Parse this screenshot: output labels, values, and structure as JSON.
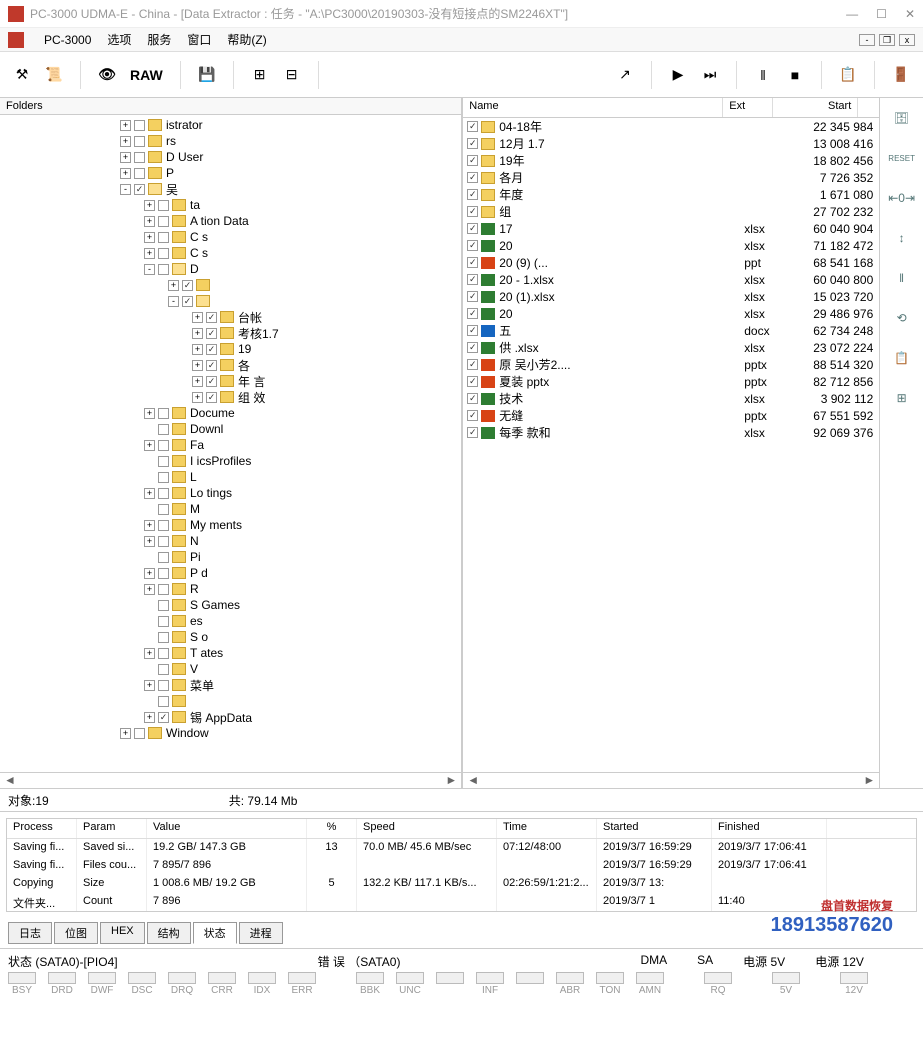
{
  "window": {
    "title": "PC-3000 UDMA-E - China - [Data Extractor : 任务 - \"A:\\PC3000\\20190303-没有短接点的SM2246XT\"]"
  },
  "menubar": {
    "app": "PC-3000",
    "items": [
      "选项",
      "服务",
      "窗口",
      "帮助(Z)"
    ]
  },
  "toolbar": {
    "raw_label": "RAW"
  },
  "sidebar_icons": [
    "RESET",
    "⇤0⇥",
    "↕",
    "‖",
    "⟲",
    "📋",
    "⊞"
  ],
  "folders_label": "Folders",
  "tree": [
    {
      "depth": 0,
      "exp": "+",
      "chk": false,
      "label": "    istrator",
      "blur": true
    },
    {
      "depth": 0,
      "exp": "+",
      "chk": false,
      "label": "    rs",
      "blur": true
    },
    {
      "depth": 0,
      "exp": "+",
      "chk": false,
      "label": "D    User",
      "blur": true
    },
    {
      "depth": 0,
      "exp": "+",
      "chk": false,
      "label": "P   ",
      "blur": true
    },
    {
      "depth": 0,
      "exp": "-",
      "chk": true,
      "open": true,
      "label": "吴  "
    },
    {
      "depth": 1,
      "exp": "+",
      "chk": false,
      "label": "    ta",
      "blur": true
    },
    {
      "depth": 1,
      "exp": "+",
      "chk": false,
      "label": "A    tion Data",
      "blur": true
    },
    {
      "depth": 1,
      "exp": "+",
      "chk": false,
      "label": "C    s",
      "blur": true
    },
    {
      "depth": 1,
      "exp": "+",
      "chk": false,
      "label": "C    s",
      "blur": true
    },
    {
      "depth": 1,
      "exp": "-",
      "chk": false,
      "open": true,
      "label": "D    ",
      "blur": true
    },
    {
      "depth": 2,
      "exp": "+",
      "chk": true,
      "label": "    ",
      "blur": true
    },
    {
      "depth": 2,
      "exp": "-",
      "chk": true,
      "open": true,
      "label": "    ",
      "blur": true
    },
    {
      "depth": 3,
      "exp": "+",
      "chk": true,
      "label": "        台帐",
      "blur": true
    },
    {
      "depth": 3,
      "exp": "+",
      "chk": true,
      "label": "        考核1.7",
      "blur": true
    },
    {
      "depth": 3,
      "exp": "+",
      "chk": true,
      "label": "19      ",
      "blur": true
    },
    {
      "depth": 3,
      "exp": "+",
      "chk": true,
      "label": "各      ",
      "blur": true
    },
    {
      "depth": 3,
      "exp": "+",
      "chk": true,
      "label": "年      言",
      "blur": true
    },
    {
      "depth": 3,
      "exp": "+",
      "chk": true,
      "label": "组    效",
      "blur": true
    },
    {
      "depth": 1,
      "exp": "+",
      "chk": false,
      "label": "Docume   ",
      "blur": true
    },
    {
      "depth": 1,
      "exp": "",
      "chk": false,
      "label": "Downl   ",
      "blur": true
    },
    {
      "depth": 1,
      "exp": "+",
      "chk": false,
      "label": "Fa   ",
      "blur": true
    },
    {
      "depth": 1,
      "exp": "",
      "chk": false,
      "label": "I      icsProfiles",
      "blur": true
    },
    {
      "depth": 1,
      "exp": "",
      "chk": false,
      "label": "L   ",
      "blur": true
    },
    {
      "depth": 1,
      "exp": "+",
      "chk": false,
      "label": "Lo    tings",
      "blur": true
    },
    {
      "depth": 1,
      "exp": "",
      "chk": false,
      "label": "M   ",
      "blur": true
    },
    {
      "depth": 1,
      "exp": "+",
      "chk": false,
      "label": "My    ments",
      "blur": true
    },
    {
      "depth": 1,
      "exp": "+",
      "chk": false,
      "label": "N   ",
      "blur": true
    },
    {
      "depth": 1,
      "exp": "",
      "chk": false,
      "label": "Pi   ",
      "blur": true
    },
    {
      "depth": 1,
      "exp": "+",
      "chk": false,
      "label": "P    d",
      "blur": true
    },
    {
      "depth": 1,
      "exp": "+",
      "chk": false,
      "label": "R   ",
      "blur": true
    },
    {
      "depth": 1,
      "exp": "",
      "chk": false,
      "label": "S     Games",
      "blur": true
    },
    {
      "depth": 1,
      "exp": "",
      "chk": false,
      "label": "    es",
      "blur": true
    },
    {
      "depth": 1,
      "exp": "",
      "chk": false,
      "label": "S    o",
      "blur": true
    },
    {
      "depth": 1,
      "exp": "+",
      "chk": false,
      "label": "T    ates",
      "blur": true
    },
    {
      "depth": 1,
      "exp": "",
      "chk": false,
      "label": "V   ",
      "blur": true
    },
    {
      "depth": 1,
      "exp": "+",
      "chk": false,
      "label": "    菜单",
      "blur": true
    },
    {
      "depth": 1,
      "exp": "",
      "chk": false,
      "label": "    ",
      "blur": true
    },
    {
      "depth": 1,
      "exp": "+",
      "chk": true,
      "label": "锡     AppData",
      "blur": true
    },
    {
      "depth": 0,
      "exp": "+",
      "chk": false,
      "label": "Window   ",
      "blur": true
    }
  ],
  "file_columns": {
    "name": "Name",
    "ext": "Ext",
    "start": "Start"
  },
  "files": [
    {
      "icon": "folder",
      "name": "04-18年",
      "ext": "",
      "start": "22 345 984"
    },
    {
      "icon": "folder",
      "name": "12月             1.7",
      "ext": "",
      "start": "13 008 416"
    },
    {
      "icon": "folder",
      "name": "19年",
      "ext": "",
      "start": "18 802 456"
    },
    {
      "icon": "folder",
      "name": "各月",
      "ext": "",
      "start": "7 726 352"
    },
    {
      "icon": "folder",
      "name": "年度",
      "ext": "",
      "start": "1 671 080"
    },
    {
      "icon": "folder",
      "name": "组",
      "ext": "",
      "start": "27 702 232"
    },
    {
      "icon": "xlsx",
      "name": "17",
      "ext": "xlsx",
      "start": "60 040 904"
    },
    {
      "icon": "xlsx",
      "name": "20",
      "ext": "xlsx",
      "start": "71 182 472"
    },
    {
      "icon": "ppt",
      "name": "20                     (9) (...",
      "ext": "ppt",
      "start": "68 541 168"
    },
    {
      "icon": "xlsx",
      "name": "20                    - 1.xlsx",
      "ext": "xlsx",
      "start": "60 040 800"
    },
    {
      "icon": "xlsx",
      "name": "20                (1).xlsx",
      "ext": "xlsx",
      "start": "15 023 720"
    },
    {
      "icon": "xlsx",
      "name": "20",
      "ext": "xlsx",
      "start": "29 486 976"
    },
    {
      "icon": "docx",
      "name": "五",
      "ext": "docx",
      "start": "62 734 248"
    },
    {
      "icon": "xlsx",
      "name": "供                   .xlsx",
      "ext": "xlsx",
      "start": "23 072 224"
    },
    {
      "icon": "pptx",
      "name": "原                   吴小芳2....",
      "ext": "pptx",
      "start": "88 514 320"
    },
    {
      "icon": "pptx",
      "name": "夏装                pptx",
      "ext": "pptx",
      "start": "82 712 856"
    },
    {
      "icon": "xlsx",
      "name": "技术",
      "ext": "xlsx",
      "start": "3 902 112"
    },
    {
      "icon": "pptx",
      "name": "无缝",
      "ext": "pptx",
      "start": "67 551 592"
    },
    {
      "icon": "xlsx",
      "name": "每季      款和",
      "ext": "xlsx",
      "start": "92 069 376"
    }
  ],
  "status": {
    "objects_label": "对象:",
    "objects": "19",
    "total_label": "共:",
    "total": "79.14 Mb"
  },
  "process_cols": [
    "Process",
    "Param",
    "Value",
    "%",
    "Speed",
    "Time",
    "Started",
    "Finished"
  ],
  "processes": [
    {
      "proc": "Saving fi...",
      "param": "Saved si...",
      "val": "19.2 GB/ 147.3 GB",
      "pct": "13",
      "spd": "70.0 MB/ 45.6 MB/sec",
      "time": "07:12/48:00",
      "started": "2019/3/7 16:59:29",
      "fin": "2019/3/7 17:06:41"
    },
    {
      "proc": "Saving fi...",
      "param": "Files cou...",
      "val": "7 895/7 896",
      "pct": "",
      "spd": "",
      "time": "",
      "started": "2019/3/7 16:59:29",
      "fin": "2019/3/7 17:06:41"
    },
    {
      "proc": "Copying",
      "param": "Size",
      "val": "1 008.6 MB/ 19.2 GB",
      "pct": "5",
      "spd": "132.2 KB/ 117.1 KB/s...",
      "time": "02:26:59/1:21:2...",
      "started": "2019/3/7 13:",
      "fin": ""
    },
    {
      "proc": "文件夹...",
      "param": "Count",
      "val": "7 896",
      "pct": "",
      "spd": "",
      "time": "",
      "started": "2019/3/7 1",
      "fin": "11:40"
    }
  ],
  "tabs": [
    "日志",
    "位图",
    "HEX",
    "结构",
    "状态",
    "进程"
  ],
  "active_tab": 4,
  "bottom": {
    "sata_status": "状态 (SATA0)-[PIO4]",
    "sata_error": "错 误 （SATA0)",
    "dma": "DMA",
    "sa": "SA",
    "power5": "电源 5V",
    "power12": "电源 12V",
    "leds1": [
      "BSY",
      "DRD",
      "DWF",
      "DSC",
      "DRQ",
      "CRR",
      "IDX",
      "ERR"
    ],
    "leds2": [
      "BBK",
      "UNC",
      "",
      "INF",
      "",
      "ABR",
      "TON",
      "AMN"
    ],
    "dma_led": "RQ",
    "power5_led": "5V",
    "power12_led": "12V"
  },
  "watermark": {
    "text": "盘首数据恢复",
    "phone": "18913587620"
  }
}
